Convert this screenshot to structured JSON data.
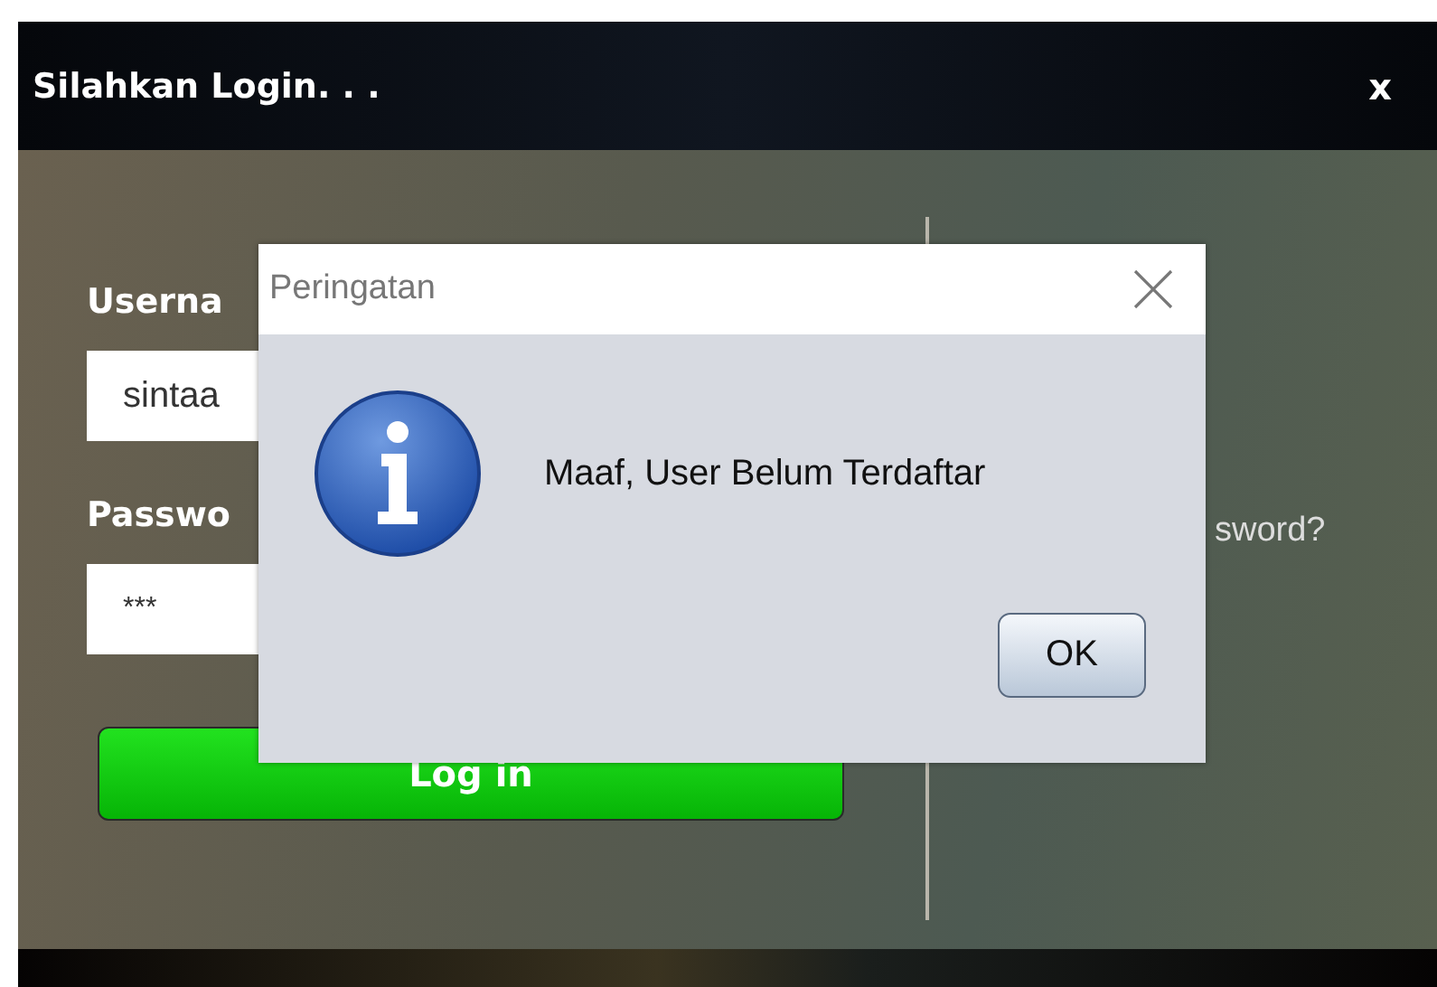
{
  "window": {
    "title": "Silahkan Login. . .",
    "close": "x"
  },
  "login_form": {
    "username_label": "Userna",
    "username_value": "sintaa",
    "password_label": "Passwo",
    "password_value": "***",
    "login_button": "Log in"
  },
  "right_panel": {
    "link": "sword?"
  },
  "dialog": {
    "title": "Peringatan",
    "message": "Maaf, User Belum Terdaftar",
    "buttons": [
      "OK"
    ]
  }
}
